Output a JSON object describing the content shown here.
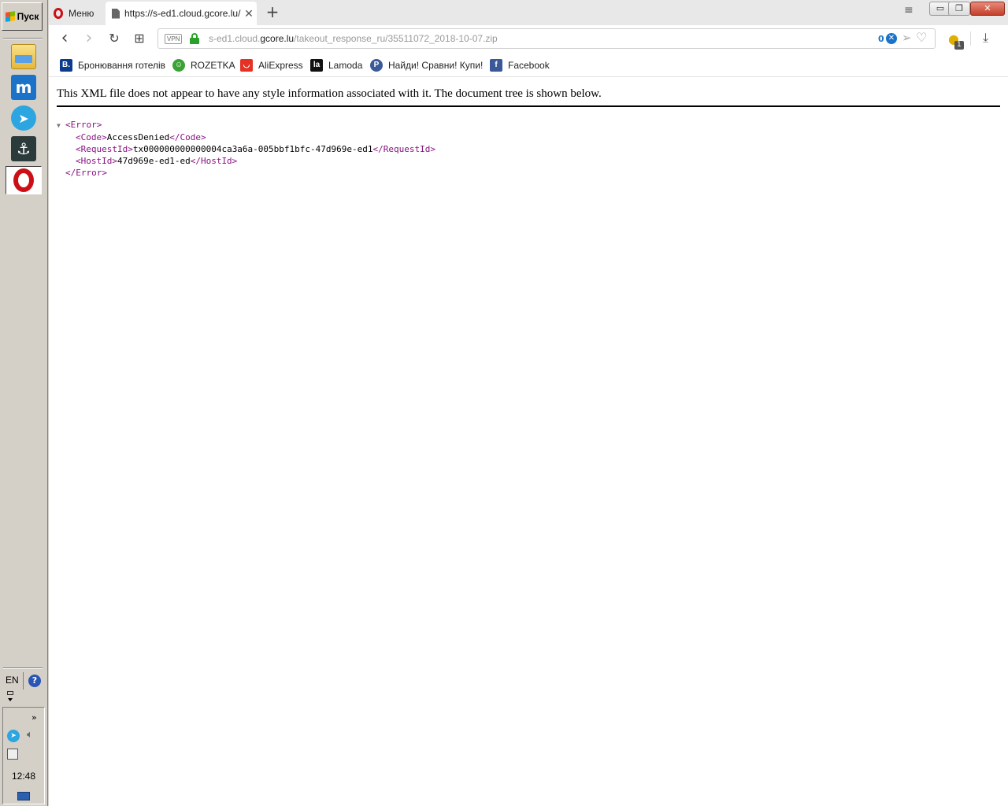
{
  "taskbar": {
    "start_label": "Пуск",
    "language": "EN",
    "clock": "12:48",
    "help_glyph": "?",
    "expand_glyph": "»"
  },
  "tabs": {
    "menu_label": "Меню",
    "active_title": "https://s-ed1.cloud.gcore.lu/",
    "close_glyph": "✕",
    "new_tab_glyph": "+"
  },
  "window": {
    "minimize_glyph": "▭",
    "restore_glyph": "❐",
    "close_glyph": "✕",
    "tabs_menu_glyph": "≡"
  },
  "toolbar": {
    "back_glyph": "‹",
    "forward_glyph": "›",
    "reload_glyph": "↻",
    "speed_dial_glyph": "⊞",
    "vpn_label": "VPN",
    "url_prefix": "s-ed1.cloud.",
    "url_host": "gcore.lu",
    "url_path": "/takeout_response_ru/35511072_2018-10-07.zip",
    "adblock_count": "0",
    "adblock_glyph": "✕",
    "send_glyph": "➢",
    "heart_glyph": "♡",
    "bulb_glyph": "●",
    "bulb_badge": "1",
    "download_glyph": "⤓"
  },
  "bookmarks": [
    {
      "label": "Бронювання готелів",
      "icon": "booking-icon",
      "glyph": "B.",
      "color": "#0b3b8c"
    },
    {
      "label": "ROZETKA",
      "icon": "rozetka-icon",
      "glyph": "☺",
      "color": "#3aa335"
    },
    {
      "label": "AliExpress",
      "icon": "aliexpress-icon",
      "glyph": "◡",
      "color": "#e43225"
    },
    {
      "label": "Lamoda",
      "icon": "lamoda-icon",
      "glyph": "la",
      "color": "#111111"
    },
    {
      "label": "Найди! Сравни! Купи!",
      "icon": "price-icon",
      "glyph": "P",
      "color": "#3a5a9a"
    },
    {
      "label": "Facebook",
      "icon": "facebook-icon",
      "glyph": "f",
      "color": "#3b5998"
    }
  ],
  "page": {
    "notice": "This XML file does not appear to have any style information associated with it. The document tree is shown below.",
    "xml": {
      "root_open": "<Error>",
      "code_open": "<Code>",
      "code_value": "AccessDenied",
      "code_close": "</Code>",
      "request_open": "<RequestId>",
      "request_value": "tx000000000000004ca3a6a-005bbf1bfc-47d969e-ed1",
      "request_close": "</RequestId>",
      "host_open": "<HostId>",
      "host_value": "47d969e-ed1-ed",
      "host_close": "</HostId>",
      "root_close": "</Error>"
    }
  },
  "colors": {
    "xml_tag": "#881280",
    "secure_lock": "#2aa12a",
    "opera_red": "#cc0f16"
  }
}
